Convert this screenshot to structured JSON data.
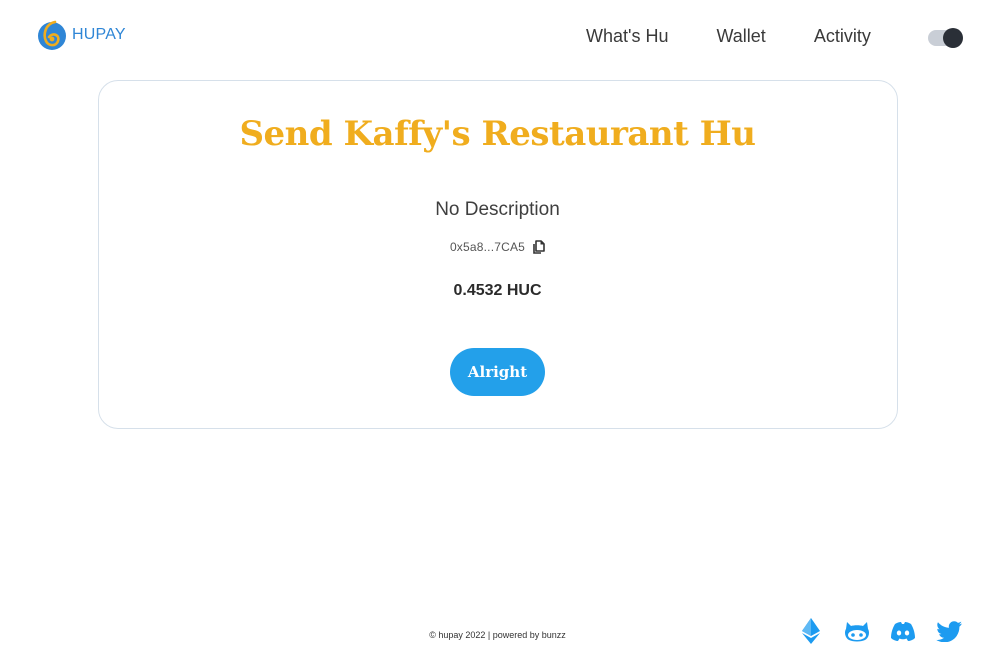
{
  "header": {
    "brand_name": "HUPAY",
    "nav": [
      {
        "label": "What's Hu"
      },
      {
        "label": "Wallet"
      },
      {
        "label": "Activity"
      }
    ],
    "theme_toggle": {
      "state": "dark"
    }
  },
  "card": {
    "title": "Send Kaffy's Restaurant Hu",
    "description": "No Description",
    "address": "0x5a8...7CA5",
    "amount": "0.4532 HUC",
    "button_label": "Alright"
  },
  "footer": {
    "copyright": "© hupay 2022 | powered by bunzz",
    "social_icons": [
      "ethereum-icon",
      "github-icon",
      "discord-icon",
      "twitter-icon"
    ]
  },
  "colors": {
    "brand_blue": "#2f86d6",
    "title_gold": "#f0ad1e",
    "button_blue": "#23a0ea",
    "icon_blue": "#1d9bf0",
    "card_border": "#d6e0ea"
  }
}
